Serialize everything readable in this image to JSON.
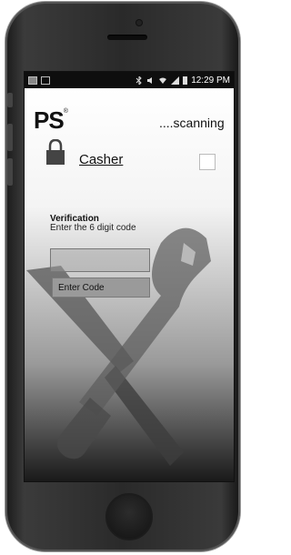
{
  "status_bar": {
    "time": "12:29 PM"
  },
  "header": {
    "logo": "PS",
    "logo_mark": "®",
    "scan_status": "....scanning"
  },
  "user": {
    "name": "Casher"
  },
  "verification": {
    "title": "Verification",
    "subtitle": "Enter the 6 digit code",
    "input_value": "",
    "button_label": "Enter Code"
  },
  "colors": {
    "screen_bg": "#ffffff",
    "art_dark": "#4a4a4a",
    "phone_body": "#2a2a2a"
  }
}
